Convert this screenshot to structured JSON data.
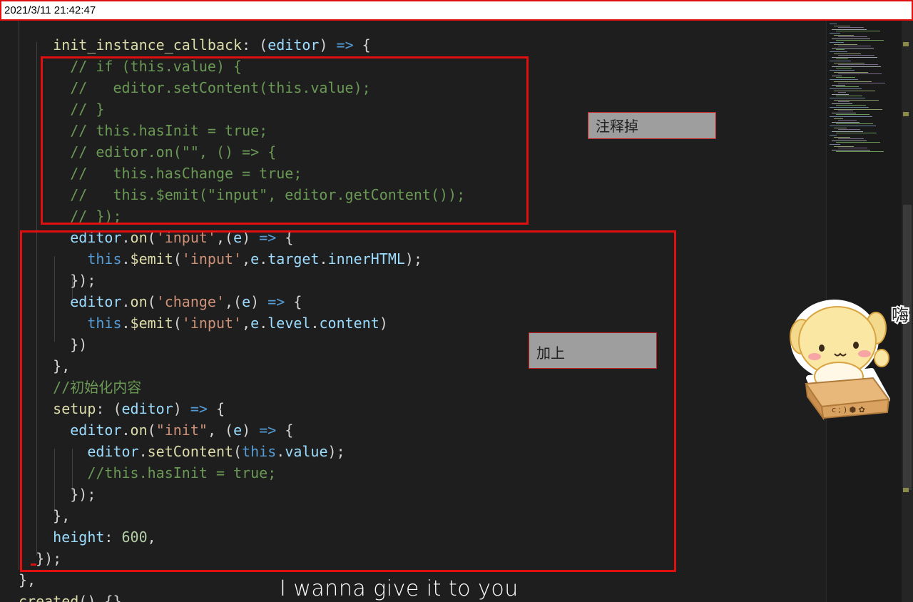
{
  "timestamp": "2021/3/11 21:42:47",
  "annotations": {
    "comment_out_label": "注释掉",
    "add_label": "加上"
  },
  "subtitle": "I wanna give it to you",
  "sticker": {
    "text": "嗨",
    "icon": "puppy-in-box-sticker"
  },
  "colors": {
    "annotation_border": "#e01010",
    "editor_bg": "#1e1e1e",
    "comment": "#6a9955",
    "keyword": "#569cd6",
    "string": "#ce9178",
    "property": "#9cdcfe",
    "function": "#dcdcaa"
  },
  "code_lines": [
    [
      [
        "    ",
        "pun"
      ],
      [
        "init_instance_callback",
        "func"
      ],
      [
        ": (",
        "pun"
      ],
      [
        "editor",
        "param"
      ],
      [
        ") ",
        "pun"
      ],
      [
        "=>",
        "kw"
      ],
      [
        " {",
        "pun"
      ]
    ],
    [
      [
        "      // if (this.value) {",
        "com"
      ]
    ],
    [
      [
        "      //   editor.setContent(this.value);",
        "com"
      ]
    ],
    [
      [
        "      // }",
        "com"
      ]
    ],
    [
      [
        "      // this.hasInit = true;",
        "com"
      ]
    ],
    [
      [
        "      // editor.on(\"\", () => {",
        "com"
      ]
    ],
    [
      [
        "      //   this.hasChange = true;",
        "com"
      ]
    ],
    [
      [
        "      //   this.$emit(\"input\", editor.getContent());",
        "com"
      ]
    ],
    [
      [
        "      // });",
        "com"
      ]
    ],
    [
      [
        "      ",
        "pun"
      ],
      [
        "editor",
        "prop"
      ],
      [
        ".",
        "pun"
      ],
      [
        "on",
        "func"
      ],
      [
        "(",
        "pun"
      ],
      [
        "'input'",
        "str"
      ],
      [
        ",(",
        "pun"
      ],
      [
        "e",
        "param"
      ],
      [
        ") ",
        "pun"
      ],
      [
        "=>",
        "kw"
      ],
      [
        " {",
        "pun"
      ]
    ],
    [
      [
        "        ",
        "pun"
      ],
      [
        "this",
        "kw"
      ],
      [
        ".",
        "pun"
      ],
      [
        "$emit",
        "func"
      ],
      [
        "(",
        "pun"
      ],
      [
        "'input'",
        "str"
      ],
      [
        ",",
        "pun"
      ],
      [
        "e",
        "prop"
      ],
      [
        ".",
        "pun"
      ],
      [
        "target",
        "prop"
      ],
      [
        ".",
        "pun"
      ],
      [
        "innerHTML",
        "prop"
      ],
      [
        ");",
        "pun"
      ]
    ],
    [
      [
        "      });",
        "pun"
      ]
    ],
    [
      [
        "      ",
        "pun"
      ],
      [
        "editor",
        "prop"
      ],
      [
        ".",
        "pun"
      ],
      [
        "on",
        "func"
      ],
      [
        "(",
        "pun"
      ],
      [
        "'change'",
        "str"
      ],
      [
        ",(",
        "pun"
      ],
      [
        "e",
        "param"
      ],
      [
        ") ",
        "pun"
      ],
      [
        "=>",
        "kw"
      ],
      [
        " {",
        "pun"
      ]
    ],
    [
      [
        "        ",
        "pun"
      ],
      [
        "this",
        "kw"
      ],
      [
        ".",
        "pun"
      ],
      [
        "$emit",
        "func"
      ],
      [
        "(",
        "pun"
      ],
      [
        "'input'",
        "str"
      ],
      [
        ",",
        "pun"
      ],
      [
        "e",
        "prop"
      ],
      [
        ".",
        "pun"
      ],
      [
        "level",
        "prop"
      ],
      [
        ".",
        "pun"
      ],
      [
        "content",
        "prop"
      ],
      [
        ")",
        "pun"
      ]
    ],
    [
      [
        "      })",
        "pun"
      ]
    ],
    [
      [
        "    },",
        "pun"
      ]
    ],
    [
      [
        "    //初始化内容",
        "com"
      ]
    ],
    [
      [
        "    ",
        "pun"
      ],
      [
        "setup",
        "func"
      ],
      [
        ": (",
        "pun"
      ],
      [
        "editor",
        "param"
      ],
      [
        ") ",
        "pun"
      ],
      [
        "=>",
        "kw"
      ],
      [
        " {",
        "pun"
      ]
    ],
    [
      [
        "      ",
        "pun"
      ],
      [
        "editor",
        "prop"
      ],
      [
        ".",
        "pun"
      ],
      [
        "on",
        "func"
      ],
      [
        "(",
        "pun"
      ],
      [
        "\"init\"",
        "str"
      ],
      [
        ", (",
        "pun"
      ],
      [
        "e",
        "param"
      ],
      [
        ") ",
        "pun"
      ],
      [
        "=>",
        "kw"
      ],
      [
        " {",
        "pun"
      ]
    ],
    [
      [
        "        ",
        "pun"
      ],
      [
        "editor",
        "prop"
      ],
      [
        ".",
        "pun"
      ],
      [
        "setContent",
        "func"
      ],
      [
        "(",
        "pun"
      ],
      [
        "this",
        "kw"
      ],
      [
        ".",
        "pun"
      ],
      [
        "value",
        "prop"
      ],
      [
        ");",
        "pun"
      ]
    ],
    [
      [
        "        //this.hasInit = true;",
        "com"
      ]
    ],
    [
      [
        "      });",
        "pun"
      ]
    ],
    [
      [
        "    },",
        "pun"
      ]
    ],
    [
      [
        "    ",
        "pun"
      ],
      [
        "height",
        "prop"
      ],
      [
        ": ",
        "pun"
      ],
      [
        "600",
        "num"
      ],
      [
        ",",
        "pun"
      ]
    ],
    [
      [
        "  });",
        "pun"
      ]
    ],
    [
      [
        "},",
        "pun"
      ]
    ],
    [
      [
        "created",
        "func"
      ],
      [
        "() {}",
        "pun"
      ]
    ]
  ]
}
